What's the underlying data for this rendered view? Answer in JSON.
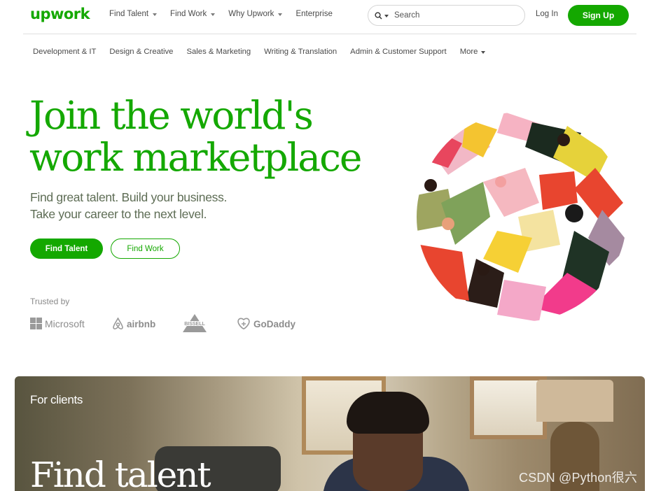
{
  "header": {
    "logo": "upwork",
    "nav": [
      {
        "label": "Find Talent",
        "has_dropdown": true
      },
      {
        "label": "Find Work",
        "has_dropdown": true
      },
      {
        "label": "Why Upwork",
        "has_dropdown": true
      },
      {
        "label": "Enterprise",
        "has_dropdown": false
      }
    ],
    "search": {
      "placeholder": "Search",
      "icon": "search-icon"
    },
    "login_label": "Log In",
    "signup_label": "Sign Up"
  },
  "categories": [
    "Development & IT",
    "Design & Creative",
    "Sales & Marketing",
    "Writing & Translation",
    "Admin & Customer Support",
    "More"
  ],
  "hero": {
    "title_line1": "Join the world's",
    "title_line2": "work marketplace",
    "subtitle_line1": "Find great talent. Build your business.",
    "subtitle_line2": "Take your career to the next level.",
    "primary_button": "Find Talent",
    "secondary_button": "Find Work",
    "trusted_label": "Trusted by",
    "brands": [
      "Microsoft",
      "airbnb",
      "BISSELL",
      "GoDaddy"
    ]
  },
  "banner": {
    "label": "For clients",
    "title": "Find talent"
  },
  "watermark": "CSDN @Python很六",
  "colors": {
    "brand_green": "#14a800",
    "text_gray": "#4a4a4a",
    "logo_gray": "#8c8c8c"
  }
}
